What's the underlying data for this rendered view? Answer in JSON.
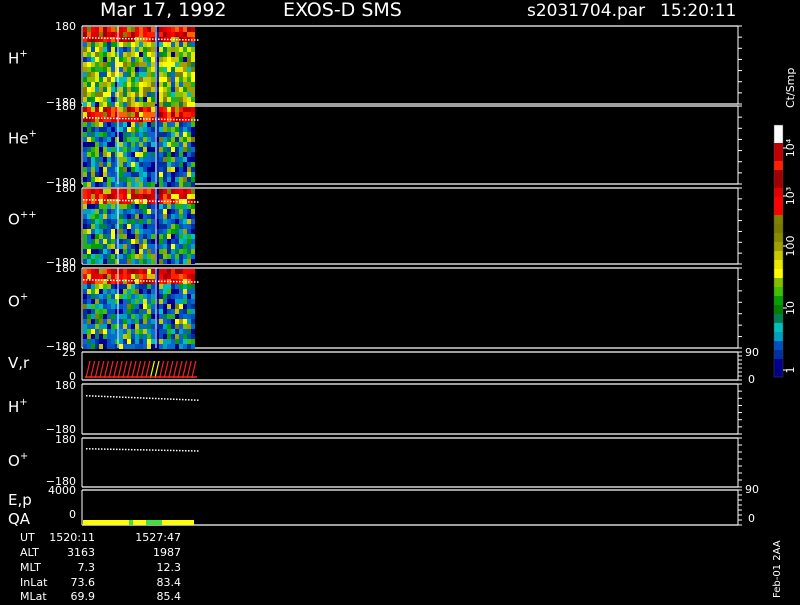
{
  "header": {
    "date": "Mar 17, 1992",
    "instrument": "EXOS-D SMS",
    "file": "s2031704.par",
    "time": "15:20:11"
  },
  "panels": [
    {
      "id": "h-plus",
      "label": "H",
      "sup": "+",
      "ymax": "180",
      "ymin": "−180"
    },
    {
      "id": "he-plus",
      "label": "He",
      "sup": "+",
      "ymax": "180",
      "ymin": "−180"
    },
    {
      "id": "o-plusplus",
      "label": "O",
      "sup": "++",
      "ymax": "180",
      "ymin": "−180"
    },
    {
      "id": "o-plus",
      "label": "O",
      "sup": "+",
      "ymax": "180",
      "ymin": "−180"
    }
  ],
  "vr_panel": {
    "label": "V,r",
    "left_top": "25",
    "left_bottom": "0",
    "right_top": "90",
    "right_bottom": "0"
  },
  "h_line_panel": {
    "label": "H",
    "sup": "+",
    "ymax": "180",
    "ymin": "−180"
  },
  "o_line_panel": {
    "label": "O",
    "sup": "+",
    "ymax": "180",
    "ymin": "−180"
  },
  "ep_panel": {
    "label1": "E,p",
    "label2": "QA",
    "left_top": "4000",
    "left_bottom": "0",
    "right_top": "90",
    "right_bottom": "0"
  },
  "colorbar": {
    "unit": "Ct/Smp",
    "tick_labels": [
      "10⁴",
      "10³",
      "100",
      "10",
      "1"
    ],
    "colors": [
      "#ffffff",
      "#ffffff",
      "#c00000",
      "#c00000",
      "#ff2000",
      "#a00000",
      "#a00000",
      "#e00000",
      "#ff0000",
      "#ff0000",
      "#808000",
      "#7a7a00",
      "#8a8a00",
      "#a0a000",
      "#c8c800",
      "#e8e800",
      "#ffff00",
      "#80c000",
      "#40c000",
      "#00a000",
      "#008000",
      "#008050",
      "#00c0c0",
      "#00a0c0",
      "#0050c0",
      "#0030a0",
      "#000090",
      "#000080"
    ]
  },
  "footer": {
    "rows": [
      {
        "label": "UT",
        "v1": "1520:11",
        "v2": "1527:47"
      },
      {
        "label": "ALT",
        "v1": "3163",
        "v2": "1987"
      },
      {
        "label": "MLT",
        "v1": "7.3",
        "v2": "12.3"
      },
      {
        "label": "InLat",
        "v1": "73.6",
        "v2": "83.4"
      },
      {
        "label": "MLat",
        "v1": "69.9",
        "v2": "85.4"
      }
    ],
    "stamp": "Feb-01 2AA"
  },
  "chart_data": {
    "type": "heatmap",
    "title": "Mar 17, 1992   EXOS-D SMS   s2031704.par  15:20:11",
    "x": [
      "1520:11",
      "1527:47"
    ],
    "series": [
      {
        "name": "H+",
        "ylim": [
          -180,
          180
        ]
      },
      {
        "name": "He+",
        "ylim": [
          -180,
          180
        ]
      },
      {
        "name": "O++",
        "ylim": [
          -180,
          180
        ]
      },
      {
        "name": "O+",
        "ylim": [
          -180,
          180
        ]
      }
    ],
    "colorbar": {
      "label": "Ct/Smp",
      "scale": "log",
      "range": [
        1,
        10000
      ]
    },
    "vr_ylim": [
      0,
      25
    ],
    "ep_ylim": [
      0,
      4000
    ],
    "grid": false
  }
}
